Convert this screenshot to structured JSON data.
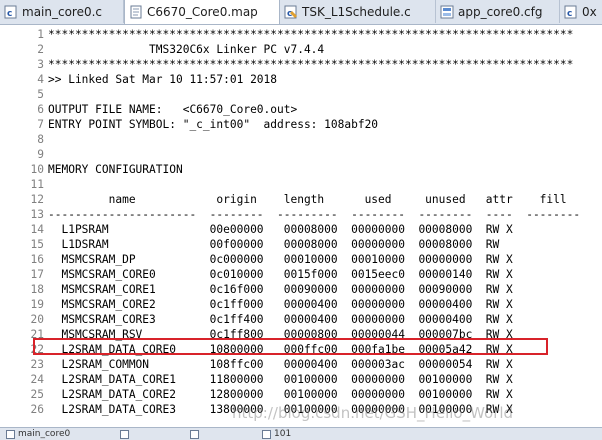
{
  "tabs": [
    {
      "label": "main_core0.c",
      "icon": "c-file-icon",
      "active": false
    },
    {
      "label": "C6670_Core0.map",
      "icon": "text-file-icon",
      "active": true
    },
    {
      "label": "TSK_L1Schedule.c",
      "icon": "c-file-icon",
      "active": false
    },
    {
      "label": "app_core0.cfg",
      "icon": "cfg-file-icon",
      "active": false
    },
    {
      "label": "0x",
      "icon": "c-file-icon",
      "active": false
    }
  ],
  "editor": {
    "lines": [
      {
        "n": "1",
        "text": "******************************************************************************"
      },
      {
        "n": "2",
        "text": "               TMS320C6x Linker PC v7.4.4"
      },
      {
        "n": "3",
        "text": "******************************************************************************"
      },
      {
        "n": "4",
        "text": ">> Linked Sat Mar 10 11:57:01 2018"
      },
      {
        "n": "5",
        "text": ""
      },
      {
        "n": "6",
        "text": "OUTPUT FILE NAME:   <C6670_Core0.out>"
      },
      {
        "n": "7",
        "text": "ENTRY POINT SYMBOL: \"_c_int00\"  address: 108abf20"
      },
      {
        "n": "8",
        "text": ""
      },
      {
        "n": "9",
        "text": ""
      },
      {
        "n": "10",
        "text": "MEMORY CONFIGURATION"
      },
      {
        "n": "11",
        "text": ""
      },
      {
        "n": "12",
        "text": "         name            origin    length      used     unused   attr    fill"
      },
      {
        "n": "13",
        "text": "----------------------  --------  ---------  --------  --------  ----  --------"
      },
      {
        "n": "14",
        "text": "  L1PSRAM               00e00000   00008000  00000000  00008000  RW X"
      },
      {
        "n": "15",
        "text": "  L1DSRAM               00f00000   00008000  00000000  00008000  RW"
      },
      {
        "n": "16",
        "text": "  MSMCSRAM_DP           0c000000   00010000  00010000  00000000  RW X"
      },
      {
        "n": "17",
        "text": "  MSMCSRAM_CORE0        0c010000   0015f000  0015eec0  00000140  RW X"
      },
      {
        "n": "18",
        "text": "  MSMCSRAM_CORE1        0c16f000   00090000  00000000  00090000  RW X"
      },
      {
        "n": "19",
        "text": "  MSMCSRAM_CORE2        0c1ff000   00000400  00000000  00000400  RW X"
      },
      {
        "n": "20",
        "text": "  MSMCSRAM_CORE3        0c1ff400   00000400  00000000  00000400  RW X"
      },
      {
        "n": "21",
        "text": "  MSMCSRAM_RSV          0c1ff800   00000800  00000044  000007bc  RW X"
      },
      {
        "n": "22",
        "text": "  L2SRAM_DATA_CORE0     10800000   000ffc00  000fa1be  00005a42  RW X"
      },
      {
        "n": "23",
        "text": "  L2SRAM_COMMON         108ffc00   00000400  000003ac  00000054  RW X"
      },
      {
        "n": "24",
        "text": "  L2SRAM_DATA_CORE1     11800000   00100000  00000000  00100000  RW X"
      },
      {
        "n": "25",
        "text": "  L2SRAM_DATA_CORE2     12800000   00100000  00000000  00100000  RW X"
      },
      {
        "n": "26",
        "text": "  L2SRAM_DATA_CORE3     13800000   00100000  00000000  00100000  RW X"
      }
    ]
  },
  "bottom_tabs": [
    {
      "label": "main_core0",
      "icon": "c-file-icon"
    },
    {
      "label": "",
      "icon": "text-file-icon"
    },
    {
      "label": "",
      "icon": "cfg-file-icon"
    },
    {
      "label": "101",
      "icon": "binary-icon"
    }
  ],
  "watermark": "http://blog.csdn.net/GSH_Hello_World",
  "colors": {
    "highlight_border": "#d8232a",
    "line_number": "#808080",
    "tab_bar": "#dde4ee"
  }
}
